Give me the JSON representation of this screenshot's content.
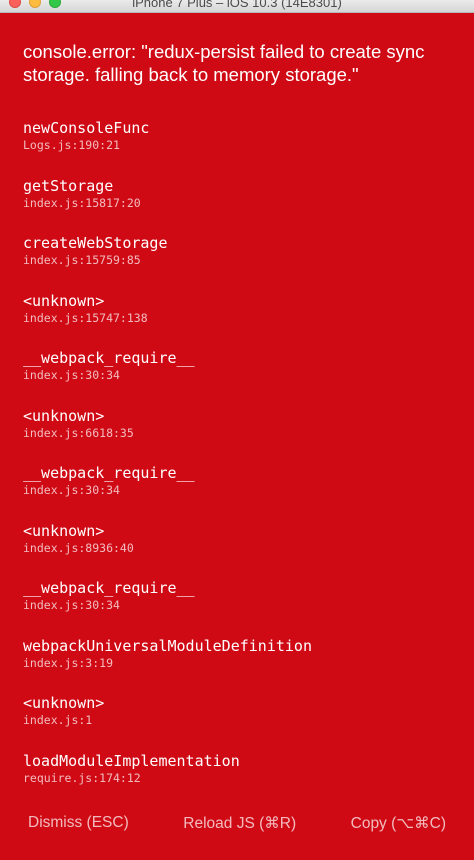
{
  "window": {
    "title": "iPhone 7 Plus – iOS 10.3 (14E8301)"
  },
  "error": {
    "message": "console.error: \"redux-persist failed to create sync storage. falling back to memory storage.\""
  },
  "stack": [
    {
      "method": "newConsoleFunc",
      "location": "Logs.js:190:21"
    },
    {
      "method": "getStorage",
      "location": "index.js:15817:20"
    },
    {
      "method": "createWebStorage",
      "location": "index.js:15759:85"
    },
    {
      "method": "<unknown>",
      "location": "index.js:15747:138"
    },
    {
      "method": "__webpack_require__",
      "location": "index.js:30:34"
    },
    {
      "method": "<unknown>",
      "location": "index.js:6618:35"
    },
    {
      "method": "__webpack_require__",
      "location": "index.js:30:34"
    },
    {
      "method": "<unknown>",
      "location": "index.js:8936:40"
    },
    {
      "method": "__webpack_require__",
      "location": "index.js:30:34"
    },
    {
      "method": "webpackUniversalModuleDefinition",
      "location": "index.js:3:19"
    },
    {
      "method": "<unknown>",
      "location": "index.js:1"
    },
    {
      "method": "loadModuleImplementation",
      "location": "require.js:174:12"
    }
  ],
  "buttons": {
    "dismiss": "Dismiss (ESC)",
    "reload": "Reload JS (⌘R)",
    "copy": "Copy (⌥⌘C)"
  },
  "colors": {
    "background": "#cf0a15",
    "text": "#ffffff"
  }
}
